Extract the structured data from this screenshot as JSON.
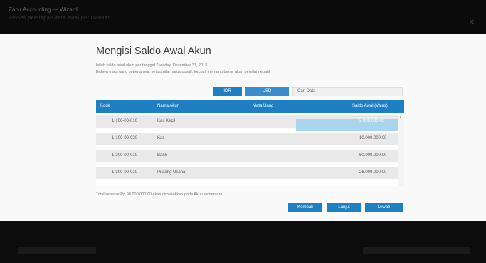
{
  "window": {
    "title": "Zahir Accounting — Wizard",
    "subtitle": "Proses persiapan data awal perusahaan"
  },
  "dialog": {
    "title": "Mengisi Saldo Awal Akun",
    "desc_line1": "Isilah saldo awal akun per tanggal Tuesday, Desember 31, 2013",
    "desc_line2": "Bahwa mata uang sebenarnya, setiap nilai harus positif, kecuali memang benar akan bernilai negatif",
    "currency_buttons": [
      "IDR",
      "USD"
    ],
    "filter_placeholder": "Cari Data"
  },
  "table": {
    "columns": [
      "Kode",
      "Nama Akun",
      "Mata Uang",
      "Saldo Awal (Valas)"
    ],
    "rows": [
      {
        "kode": "1-100-00-010",
        "nama": "Kas Kecil",
        "mata_uang": "",
        "saldo": "2.000.000,00"
      },
      {
        "kode": "1-100-00-020",
        "nama": "Kas",
        "mata_uang": "",
        "saldo": "10.000.000,00"
      },
      {
        "kode": "1-200-00-010",
        "nama": "Bank",
        "mata_uang": "",
        "saldo": "60.000.000,00"
      },
      {
        "kode": "1-300-00-010",
        "nama": "Piutang Usaha",
        "mata_uang": "",
        "saldo": "26.000.000,00"
      }
    ],
    "active_row_index": 0
  },
  "footer_note": "Total sebesar Rp 98.000.000,00 akan dimasukkan pada Akun sementara",
  "footer_buttons": {
    "prev": "Kembali",
    "next": "Lanjut",
    "skip": "Lewati"
  },
  "colors": {
    "accent": "#1e7fc2",
    "active_cell": "#a8d4ee",
    "row_bg": "#e9e9e9",
    "backdrop": "#0a0a0a"
  }
}
